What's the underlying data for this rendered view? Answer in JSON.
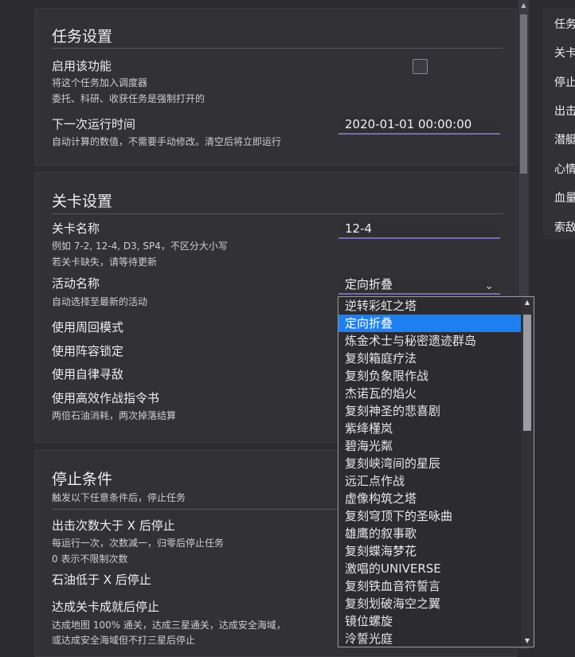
{
  "task_settings": {
    "title": "任务设置",
    "enable_label": "启用该功能",
    "enable_help_1": "将这个任务加入调度器",
    "enable_help_2": "委托、科研、收获任务是强制打开的",
    "next_run_label": "下一次运行时间",
    "next_run_help": "自动计算的数值，不需要手动修改。清空后将立即运行",
    "next_run_value": "2020-01-01 00:00:00"
  },
  "stage_settings": {
    "title": "关卡设置",
    "stage_name_label": "关卡名称",
    "stage_name_help_1": "例如 7-2, 12-4, D3, SP4，不区分大小写",
    "stage_name_help_2": "若关卡缺失，请等待更新",
    "stage_name_value": "12-4",
    "event_name_label": "活动名称",
    "event_name_help": "自动选择至最新的活动",
    "event_name_value": "定向折叠",
    "loop_mode_label": "使用周回模式",
    "fleet_lock_label": "使用阵容锁定",
    "auto_search_label": "使用自律寻敌",
    "efficient_order_label": "使用高效作战指令书",
    "efficient_order_help": "两倍石油消耗，两次掉落结算"
  },
  "stop_conditions": {
    "title": "停止条件",
    "subtitle": "触发以下任意条件后，停止任务",
    "run_count_label": "出击次数大于 X 后停止",
    "run_count_help_1": "每运行一次，次数减一，归零后停止任务",
    "run_count_help_2": "0 表示不限制次数",
    "oil_label": "石油低于 X 后停止",
    "achievement_label": "达成关卡成就后停止",
    "achievement_help_1": "达成地图 100% 通关，达成三星通关，达成安全海域，",
    "achievement_help_2": "或达成安全海域但不打三星后停止"
  },
  "right_panel": {
    "items": [
      "任务",
      "关卡",
      "停止",
      "出击",
      "潜艇",
      "心情",
      "血量",
      "索敌"
    ]
  },
  "dropdown": {
    "selected": "定向折叠",
    "options": [
      "逆转彩虹之塔",
      "定向折叠",
      "炼金术士与秘密遗迹群岛",
      "复刻箱庭疗法",
      "复刻负象限作战",
      "杰诺瓦的焰火",
      "复刻神圣的悲喜剧",
      "紫绛槿岚",
      "碧海光粼",
      "复刻峡湾间的星辰",
      "远汇点作战",
      "虚像构筑之塔",
      "复刻穹顶下的圣咏曲",
      "雄鹰的叙事歌",
      "复刻蝶海梦花",
      "激唱的UNIVERSE",
      "复刻铁血音符誓言",
      "复刻划破海空之翼",
      "镜位螺旋",
      "泠誓光庭"
    ]
  },
  "colors": {
    "selection": "#1f7ff0",
    "underline": "#7a6bb0",
    "background": "#2b2b30",
    "card": "#313136"
  }
}
